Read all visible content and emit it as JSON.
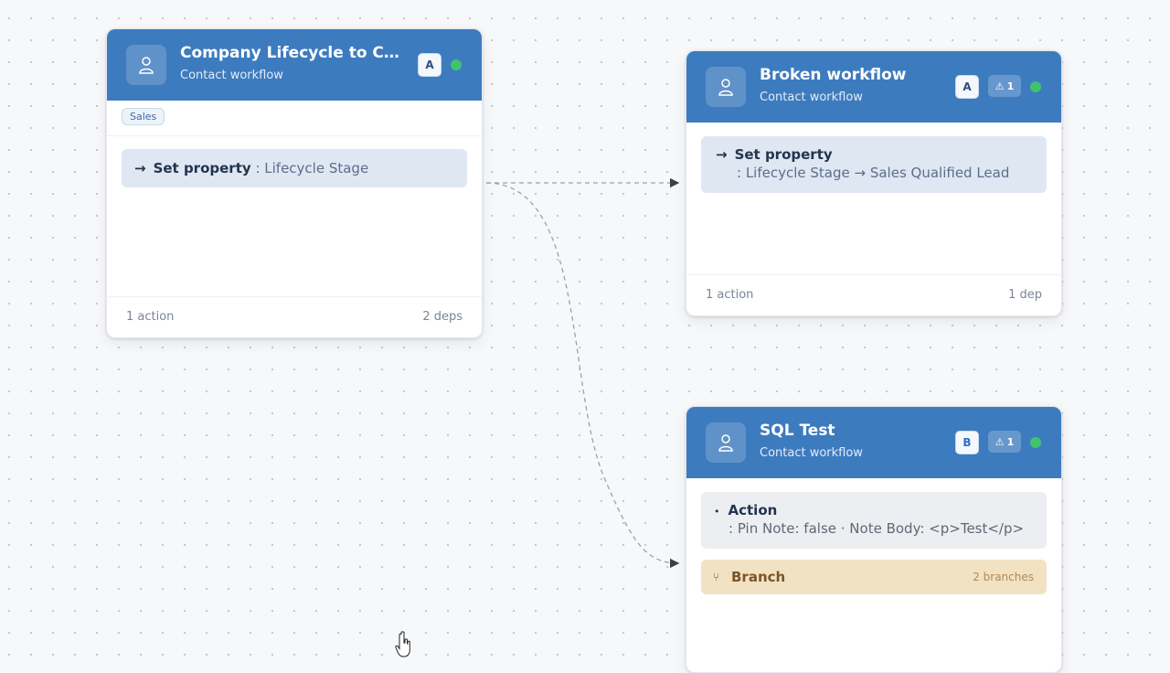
{
  "cards": [
    {
      "title": "Company Lifecycle to Con...",
      "subtitle": "Contact workflow",
      "badge": "A",
      "tag": "Sales",
      "step": {
        "arrow": "→",
        "name": "Set property",
        "detail": ": Lifecycle Stage"
      },
      "footer_left": "1 action",
      "footer_right": "2 deps"
    },
    {
      "title": "Broken workflow",
      "subtitle": "Contact workflow",
      "badge": "A",
      "warning_count": "1",
      "step": {
        "arrow": "→",
        "name": "Set property",
        "detail": ": Lifecycle Stage → Sales Qualified Lead"
      },
      "footer_left": "1 action",
      "footer_right": "1 dep"
    },
    {
      "title": "SQL Test",
      "subtitle": "Contact workflow",
      "badge": "B",
      "warning_count": "1",
      "action": {
        "bullet": "•",
        "name": "Action",
        "detail": ": Pin Note: false · Note Body: <p>Test</p>"
      },
      "branch": {
        "name": "Branch",
        "count": "2 branches"
      }
    }
  ],
  "colors": {
    "header": "#3d7bbf",
    "status": "#3ec46d",
    "branch_bg": "#f1e2c3"
  }
}
